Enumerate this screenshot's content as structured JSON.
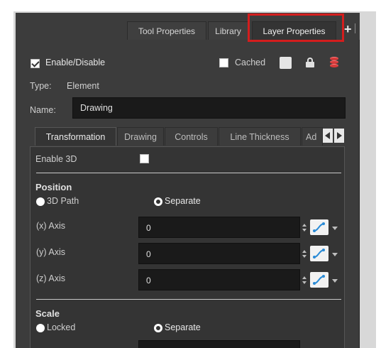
{
  "tabs": [
    {
      "label": "Tool Properties"
    },
    {
      "label": "Library"
    },
    {
      "label": "Layer Properties"
    }
  ],
  "header": {
    "enable_label": "Enable/Disable",
    "enable_checked": true,
    "cached_label": "Cached",
    "cached_checked": false
  },
  "type": {
    "label": "Type:",
    "value": "Element"
  },
  "name": {
    "label": "Name:",
    "value": "Drawing"
  },
  "inner_tabs": [
    {
      "label": "Transformation",
      "active": true
    },
    {
      "label": "Drawing"
    },
    {
      "label": "Controls"
    },
    {
      "label": "Line Thickness"
    },
    {
      "label": "Ad"
    }
  ],
  "transformation": {
    "enable3d_label": "Enable 3D",
    "enable3d_checked": false,
    "position": {
      "title": "Position",
      "option_3dpath": "3D Path",
      "option_separate": "Separate",
      "selected": "Separate",
      "axes": [
        {
          "label": "(x) Axis",
          "value": "0"
        },
        {
          "label": "(y) Axis",
          "value": "0"
        },
        {
          "label": "(z) Axis",
          "value": "0"
        }
      ]
    },
    "scale": {
      "title": "Scale",
      "option_locked": "Locked",
      "option_separate": "Separate",
      "selected": "Separate"
    }
  },
  "colors": {
    "highlight": "#d41d1d",
    "panel": "#3c3c3c",
    "field": "#1a1a1a"
  },
  "icons": [
    "plus-icon",
    "close-icon",
    "lock-icon",
    "database-icon",
    "function-curve-icon",
    "chevron-down-icon",
    "spinner-icon"
  ]
}
